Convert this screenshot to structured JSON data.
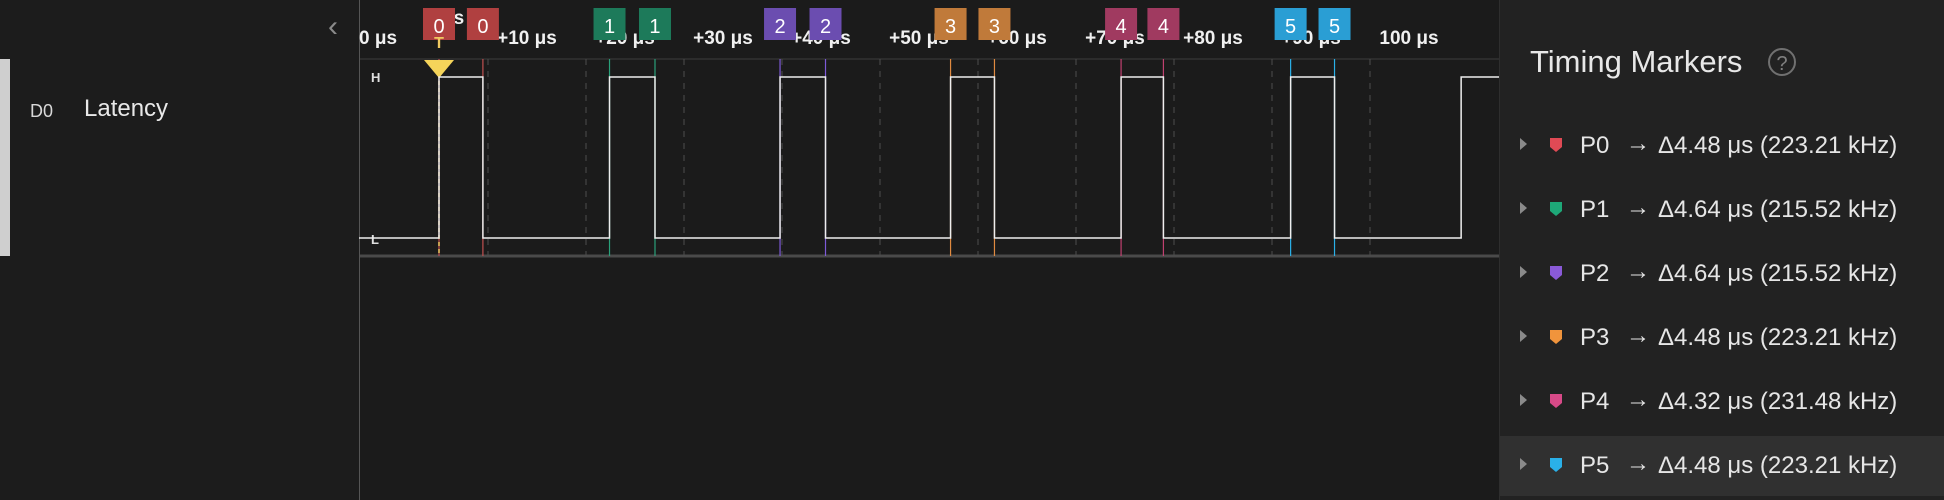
{
  "channel": {
    "id": "D0",
    "name": "Latency"
  },
  "nav": {
    "collapse_icon": "chevron-left-icon"
  },
  "axis": {
    "origin_label": "0 s",
    "ticks": [
      "0 μs",
      "+10 μs",
      "+20 μs",
      "+30 μs",
      "+40 μs",
      "+50 μs",
      "+60 μs",
      "+70 μs",
      "+80 μs",
      "+90 μs",
      "100 μs"
    ],
    "level_high": "H",
    "level_low": "L",
    "trigger_label": "T"
  },
  "marker_flags": [
    {
      "label": "0",
      "color": "#b04040"
    },
    {
      "label": "0",
      "color": "#b04040"
    },
    {
      "label": "1",
      "color": "#1d7a5a"
    },
    {
      "label": "1",
      "color": "#1d7a5a"
    },
    {
      "label": "2",
      "color": "#6b4db0"
    },
    {
      "label": "2",
      "color": "#6b4db0"
    },
    {
      "label": "3",
      "color": "#c07a3a"
    },
    {
      "label": "3",
      "color": "#c07a3a"
    },
    {
      "label": "4",
      "color": "#a03a60"
    },
    {
      "label": "4",
      "color": "#a03a60"
    },
    {
      "label": "5",
      "color": "#2a9ed4"
    },
    {
      "label": "5",
      "color": "#2a9ed4"
    }
  ],
  "signal": {
    "unit": "μs",
    "trigger_time": 0,
    "transitions": [
      {
        "t": 0,
        "level": "H"
      },
      {
        "t": 4.48,
        "level": "L"
      },
      {
        "t": 17.4,
        "level": "H"
      },
      {
        "t": 22.04,
        "level": "L"
      },
      {
        "t": 34.8,
        "level": "H"
      },
      {
        "t": 39.44,
        "level": "L"
      },
      {
        "t": 52.2,
        "level": "H"
      },
      {
        "t": 56.68,
        "level": "L"
      },
      {
        "t": 69.6,
        "level": "H"
      },
      {
        "t": 73.92,
        "level": "L"
      },
      {
        "t": 86.9,
        "level": "H"
      },
      {
        "t": 91.38,
        "level": "L"
      },
      {
        "t": 104.3,
        "level": "H"
      }
    ]
  },
  "panel": {
    "title": "Timing Markers",
    "help_icon": "?",
    "arrow": "→",
    "markers": [
      {
        "name": "P0",
        "value": "Δ4.48 μs (223.21 kHz)",
        "color": "#e04a55",
        "selected": false
      },
      {
        "name": "P1",
        "value": "Δ4.64 μs (215.52 kHz)",
        "color": "#1ea878",
        "selected": false
      },
      {
        "name": "P2",
        "value": "Δ4.64 μs (215.52 kHz)",
        "color": "#8a5ad8",
        "selected": false
      },
      {
        "name": "P3",
        "value": "Δ4.48 μs (223.21 kHz)",
        "color": "#f0943c",
        "selected": false
      },
      {
        "name": "P4",
        "value": "Δ4.32 μs (231.48 kHz)",
        "color": "#d84a88",
        "selected": false
      },
      {
        "name": "P5",
        "value": "Δ4.48 μs (223.21 kHz)",
        "color": "#2ab0e8",
        "selected": true
      }
    ]
  }
}
